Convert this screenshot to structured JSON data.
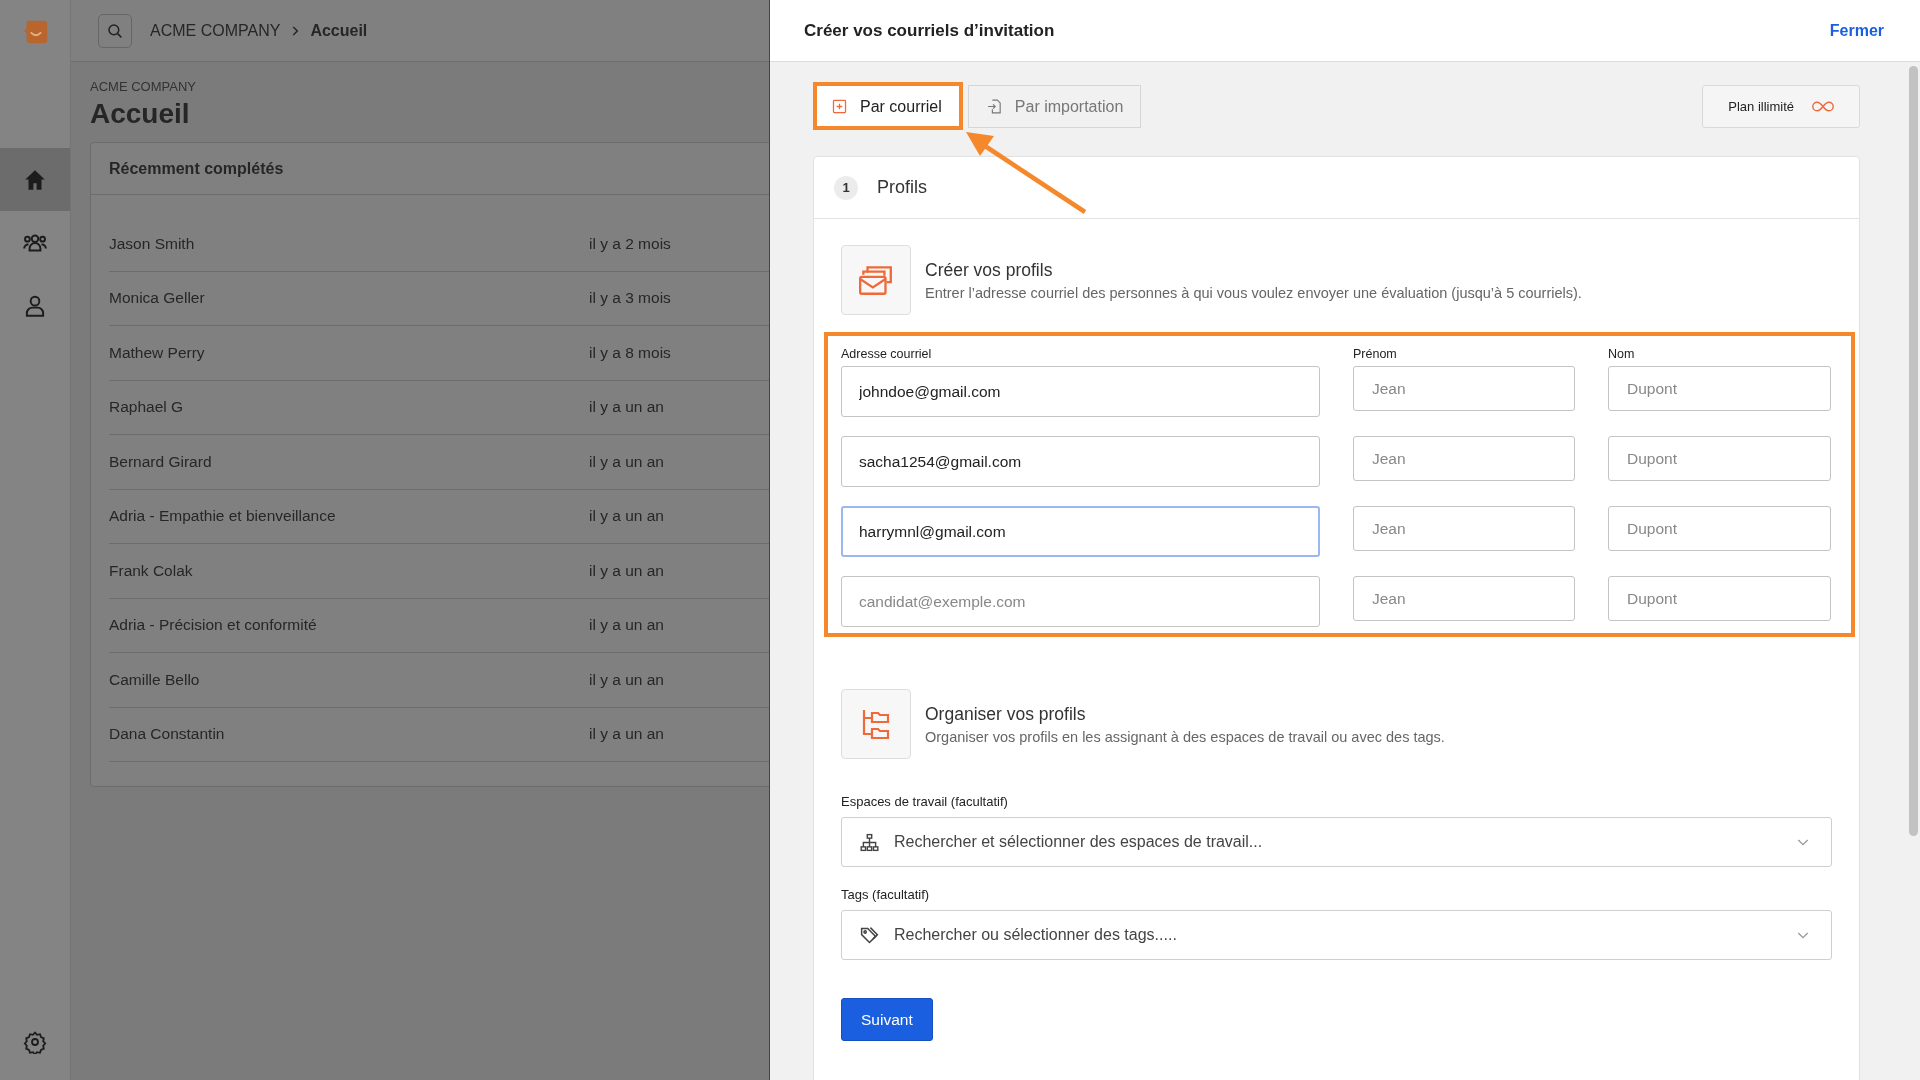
{
  "sidebar": {
    "items": [
      {
        "kind": "home",
        "selected": true
      },
      {
        "kind": "people",
        "selected": false
      },
      {
        "kind": "person",
        "selected": false
      }
    ]
  },
  "topbar": {
    "breadcrumb": [
      "ACME COMPANY",
      "Accueil"
    ]
  },
  "page": {
    "company": "ACME COMPANY",
    "title": "Accueil"
  },
  "recent": {
    "title": "Récemment complétés",
    "rows": [
      {
        "name": "Jason Smith",
        "when": "il y a 2 mois"
      },
      {
        "name": "Monica Geller",
        "when": "il y a 3 mois"
      },
      {
        "name": "Mathew Perry",
        "when": "il y a 8 mois"
      },
      {
        "name": "Raphael G",
        "when": "il y a un an"
      },
      {
        "name": "Bernard Girard",
        "when": "il y a un an"
      },
      {
        "name": "Adria - Empathie et bienveillance",
        "when": "il y a un an"
      },
      {
        "name": "Frank Colak",
        "when": "il y a un an"
      },
      {
        "name": "Adria - Précision et conformité",
        "when": "il y a un an"
      },
      {
        "name": "Camille Bello",
        "when": "il y a un an"
      },
      {
        "name": "Dana Constantin",
        "when": "il y a un an"
      }
    ]
  },
  "panel": {
    "title": "Créer vos courriels d’invitation",
    "close": "Fermer",
    "tabs": [
      {
        "label": "Par courriel",
        "kind": "manual",
        "selected": true
      },
      {
        "label": "Par importation",
        "kind": "import",
        "selected": false
      }
    ],
    "plan": "Plan illimité",
    "step": {
      "number": "1",
      "title": "Profils"
    },
    "create": {
      "title": "Créer vos profils",
      "description": "Entrer l’adresse courriel des personnes à qui vous voulez envoyer une évaluation (jusqu’à 5 courriels).",
      "columns": [
        "Adresse courriel",
        "Prénom",
        "Nom"
      ],
      "rows": [
        {
          "email": {
            "value": "johndoe@gmail.com",
            "focused": false
          },
          "first_name": {
            "placeholder": "Jean"
          },
          "last_name": {
            "placeholder": "Dupont"
          }
        },
        {
          "email": {
            "value": "sacha1254@gmail.com",
            "focused": false
          },
          "first_name": {
            "placeholder": "Jean"
          },
          "last_name": {
            "placeholder": "Dupont"
          }
        },
        {
          "email": {
            "value": "harrymnl@gmail.com",
            "focused": true
          },
          "first_name": {
            "placeholder": "Jean"
          },
          "last_name": {
            "placeholder": "Dupont"
          }
        },
        {
          "email": {
            "placeholder": "candidat@exemple.com",
            "focused": false
          },
          "first_name": {
            "placeholder": "Jean"
          },
          "last_name": {
            "placeholder": "Dupont"
          }
        }
      ]
    },
    "organize": {
      "title": "Organiser vos profils",
      "description": "Organiser vos profils en les assignant à des espaces de travail ou avec des tags.",
      "fields": [
        {
          "kind": "workspace",
          "label": "Espaces de travail (facultatif)",
          "placeholder": "Rechercher et sélectionner des espaces de travail..."
        },
        {
          "kind": "tags",
          "label": "Tags (facultatif)",
          "placeholder": "Rechercher ou sélectionner des tags....."
        }
      ]
    },
    "next": "Suivant"
  }
}
